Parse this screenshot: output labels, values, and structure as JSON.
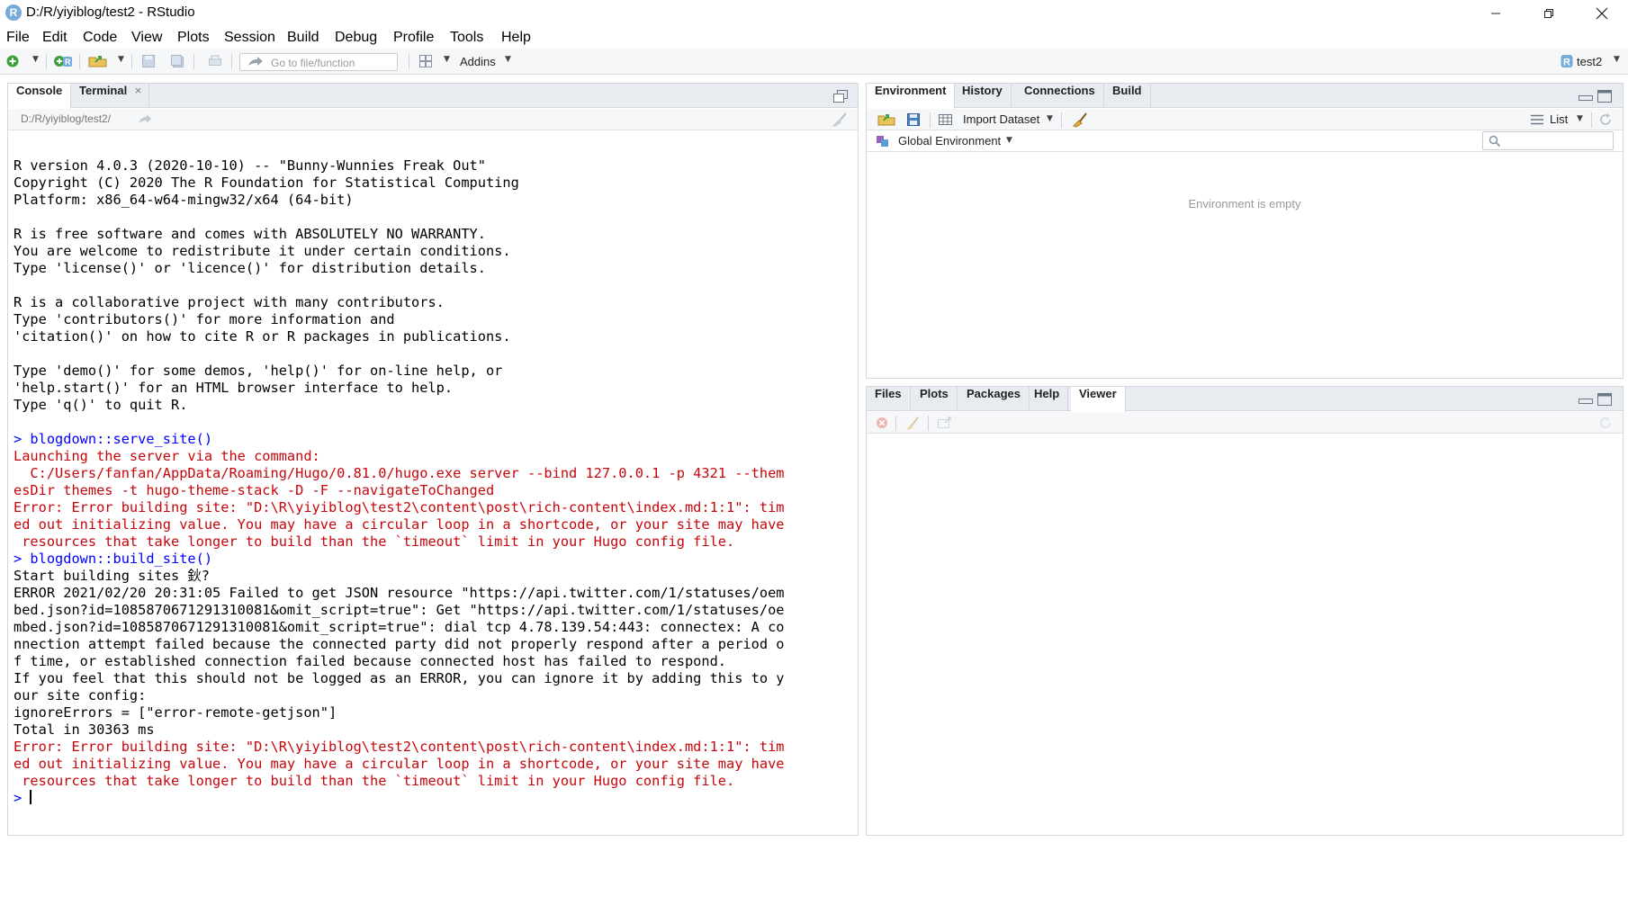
{
  "window": {
    "title": "D:/R/yiyiblog/test2 - RStudio",
    "app_icon_letter": "R",
    "minimize_icon": "minimize-icon",
    "restore_icon": "restore-icon",
    "close_icon": "close-icon"
  },
  "menu": [
    "File",
    "Edit",
    "Code",
    "View",
    "Plots",
    "Session",
    "Build",
    "Debug",
    "Profile",
    "Tools",
    "Help"
  ],
  "toolbar": {
    "goto_placeholder": "Go to file/function",
    "addins_label": "Addins",
    "project_name": "test2"
  },
  "console_pane": {
    "tabs": [
      "Console",
      "Terminal"
    ],
    "active_tab": "Console",
    "path": "D:/R/yiyiblog/test2/",
    "lines": [
      {
        "text": "",
        "kind": "out"
      },
      {
        "text": "R version 4.0.3 (2020-10-10) -- \"Bunny-Wunnies Freak Out\"",
        "kind": "out"
      },
      {
        "text": "Copyright (C) 2020 The R Foundation for Statistical Computing",
        "kind": "out"
      },
      {
        "text": "Platform: x86_64-w64-mingw32/x64 (64-bit)",
        "kind": "out"
      },
      {
        "text": "",
        "kind": "out"
      },
      {
        "text": "R is free software and comes with ABSOLUTELY NO WARRANTY.",
        "kind": "out"
      },
      {
        "text": "You are welcome to redistribute it under certain conditions.",
        "kind": "out"
      },
      {
        "text": "Type 'license()' or 'licence()' for distribution details.",
        "kind": "out"
      },
      {
        "text": "",
        "kind": "out"
      },
      {
        "text": "R is a collaborative project with many contributors.",
        "kind": "out"
      },
      {
        "text": "Type 'contributors()' for more information and",
        "kind": "out"
      },
      {
        "text": "'citation()' on how to cite R or R packages in publications.",
        "kind": "out"
      },
      {
        "text": "",
        "kind": "out"
      },
      {
        "text": "Type 'demo()' for some demos, 'help()' for on-line help, or",
        "kind": "out"
      },
      {
        "text": "'help.start()' for an HTML browser interface to help.",
        "kind": "out"
      },
      {
        "text": "Type 'q()' to quit R.",
        "kind": "out"
      },
      {
        "text": "",
        "kind": "out"
      },
      {
        "text": "> blogdown::serve_site()",
        "kind": "cmd"
      },
      {
        "text": "Launching the server via the command:",
        "kind": "err"
      },
      {
        "text": "  C:/Users/fanfan/AppData/Roaming/Hugo/0.81.0/hugo.exe server --bind 127.0.0.1 -p 4321 --them",
        "kind": "err"
      },
      {
        "text": "esDir themes -t hugo-theme-stack -D -F --navigateToChanged",
        "kind": "err"
      },
      {
        "text": "Error: Error building site: \"D:\\R\\yiyiblog\\test2\\content\\post\\rich-content\\index.md:1:1\": tim",
        "kind": "err"
      },
      {
        "text": "ed out initializing value. You may have a circular loop in a shortcode, or your site may have",
        "kind": "err"
      },
      {
        "text": " resources that take longer to build than the `timeout` limit in your Hugo config file.",
        "kind": "err"
      },
      {
        "text": "> blogdown::build_site()",
        "kind": "cmd"
      },
      {
        "text": "Start building sites 鈥?",
        "kind": "out"
      },
      {
        "text": "ERROR 2021/02/20 20:31:05 Failed to get JSON resource \"https://api.twitter.com/1/statuses/oem",
        "kind": "out"
      },
      {
        "text": "bed.json?id=1085870671291310081&omit_script=true\": Get \"https://api.twitter.com/1/statuses/oe",
        "kind": "out"
      },
      {
        "text": "mbed.json?id=1085870671291310081&omit_script=true\": dial tcp 4.78.139.54:443: connectex: A co",
        "kind": "out"
      },
      {
        "text": "nnection attempt failed because the connected party did not properly respond after a period o",
        "kind": "out"
      },
      {
        "text": "f time, or established connection failed because connected host has failed to respond.",
        "kind": "out"
      },
      {
        "text": "If you feel that this should not be logged as an ERROR, you can ignore it by adding this to y",
        "kind": "out"
      },
      {
        "text": "our site config:",
        "kind": "out"
      },
      {
        "text": "ignoreErrors = [\"error-remote-getjson\"]",
        "kind": "out"
      },
      {
        "text": "Total in 30363 ms",
        "kind": "out"
      },
      {
        "text": "Error: Error building site: \"D:\\R\\yiyiblog\\test2\\content\\post\\rich-content\\index.md:1:1\": tim",
        "kind": "err"
      },
      {
        "text": "ed out initializing value. You may have a circular loop in a shortcode, or your site may have",
        "kind": "err"
      },
      {
        "text": " resources that take longer to build than the `timeout` limit in your Hugo config file.",
        "kind": "err"
      }
    ],
    "prompt": "> "
  },
  "env_pane": {
    "tabs": [
      "Environment",
      "History",
      "Connections",
      "Build"
    ],
    "active_tab": "Environment",
    "import_dataset_label": "Import Dataset",
    "list_label": "List",
    "scope_label": "Global Environment",
    "search_placeholder": "",
    "empty_message": "Environment is empty"
  },
  "viewer_pane": {
    "tabs": [
      "Files",
      "Plots",
      "Packages",
      "Help",
      "Viewer"
    ],
    "active_tab": "Viewer"
  },
  "colors": {
    "command": "#0000ff",
    "error": "#c5060b",
    "tabstrip": "#e8ecf0",
    "r_blue": "#75aadb"
  }
}
